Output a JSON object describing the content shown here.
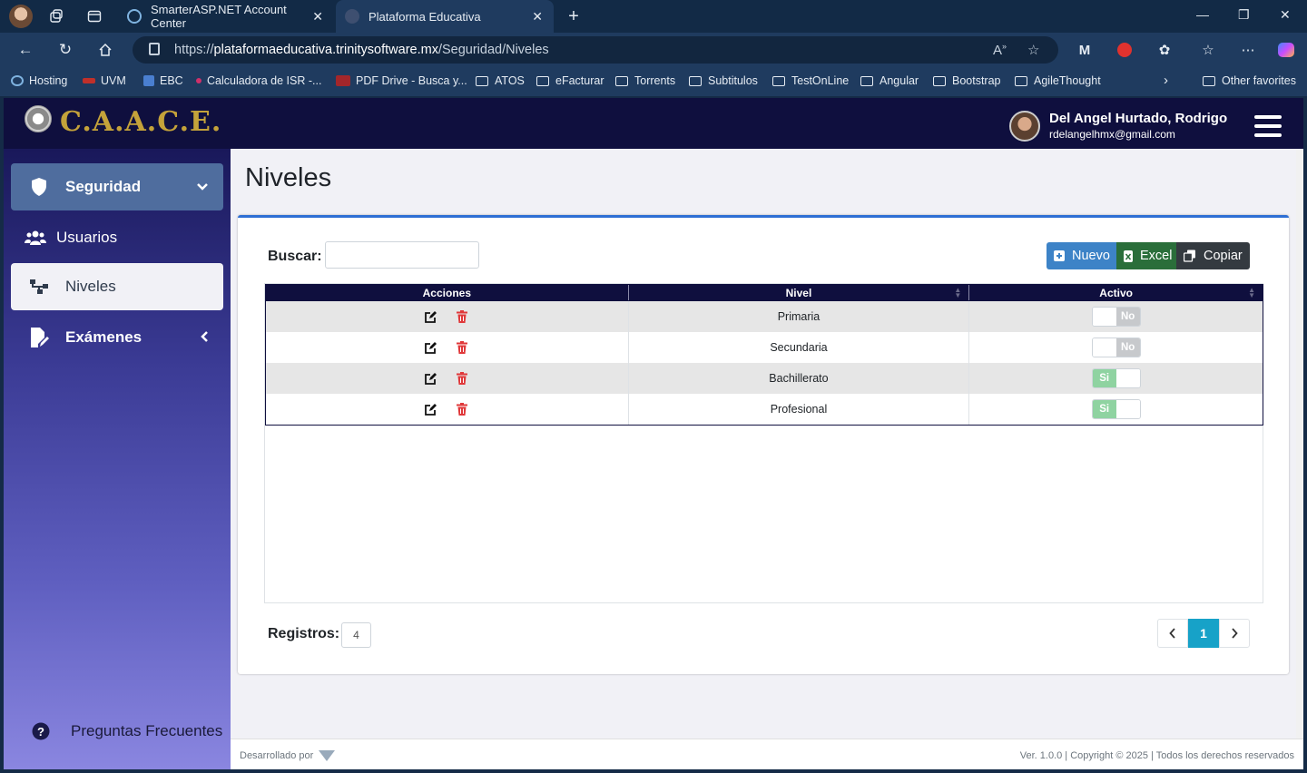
{
  "browser": {
    "tabs": [
      {
        "title": "SmarterASP.NET Account Center",
        "active": false
      },
      {
        "title": "Plataforma Educativa",
        "active": true
      }
    ],
    "url_prefix": "https://",
    "url_host": "plataformaeducativa.trinitysoftware.mx",
    "url_path": "/Seguridad/Niveles",
    "favorites": [
      "Hosting",
      "UVM",
      "EBC",
      "Calculadora de ISR -...",
      "PDF Drive - Busca y...",
      "ATOS",
      "eFacturar",
      "Torrents",
      "Subtitulos",
      "TestOnLine",
      "Angular",
      "Bootstrap",
      "AgileThought"
    ],
    "other_favorites": "Other favorites"
  },
  "app": {
    "logo_text": "C.A.A.C.E.",
    "user": {
      "name": "Del Angel Hurtado, Rodrigo",
      "email": "rdelangelhmx@gmail.com"
    },
    "sidebar": {
      "items": [
        {
          "label": "Seguridad",
          "icon": "shield-icon"
        },
        {
          "label": "Usuarios",
          "icon": "users-icon"
        },
        {
          "label": "Niveles",
          "icon": "sitemap-icon"
        },
        {
          "label": "Exámenes",
          "icon": "file-edit-icon"
        }
      ],
      "faq": "Preguntas Frecuentes"
    },
    "page_title": "Niveles",
    "search": {
      "label": "Buscar:",
      "value": "",
      "placeholder": ""
    },
    "buttons": {
      "nuevo": "Nuevo",
      "excel": "Excel",
      "copiar": "Copiar"
    },
    "table": {
      "columns": [
        "Acciones",
        "Nivel",
        "Activo"
      ],
      "rows": [
        {
          "nivel": "Primaria",
          "activo": "No"
        },
        {
          "nivel": "Secundaria",
          "activo": "No"
        },
        {
          "nivel": "Bachillerato",
          "activo": "Si"
        },
        {
          "nivel": "Profesional",
          "activo": "Si"
        }
      ]
    },
    "registros": {
      "label": "Registros:",
      "count": "4"
    },
    "pagination": {
      "prev": "‹",
      "current": "1",
      "next": "›"
    },
    "footer": {
      "left": "Desarrollado por",
      "right": "Ver. 1.0.0 | Copyright © 2025 | Todos los derechos reservados"
    },
    "colors": {
      "nav": "#0f0f3e",
      "accent": "#2e6fd4",
      "nuevo": "#3d83c7",
      "excel": "#2a6e3a",
      "copiar": "#343a40",
      "page_active": "#17a2c8",
      "toggle_si": "#8fd3a1",
      "toggle_no": "#c7c9cc"
    }
  }
}
